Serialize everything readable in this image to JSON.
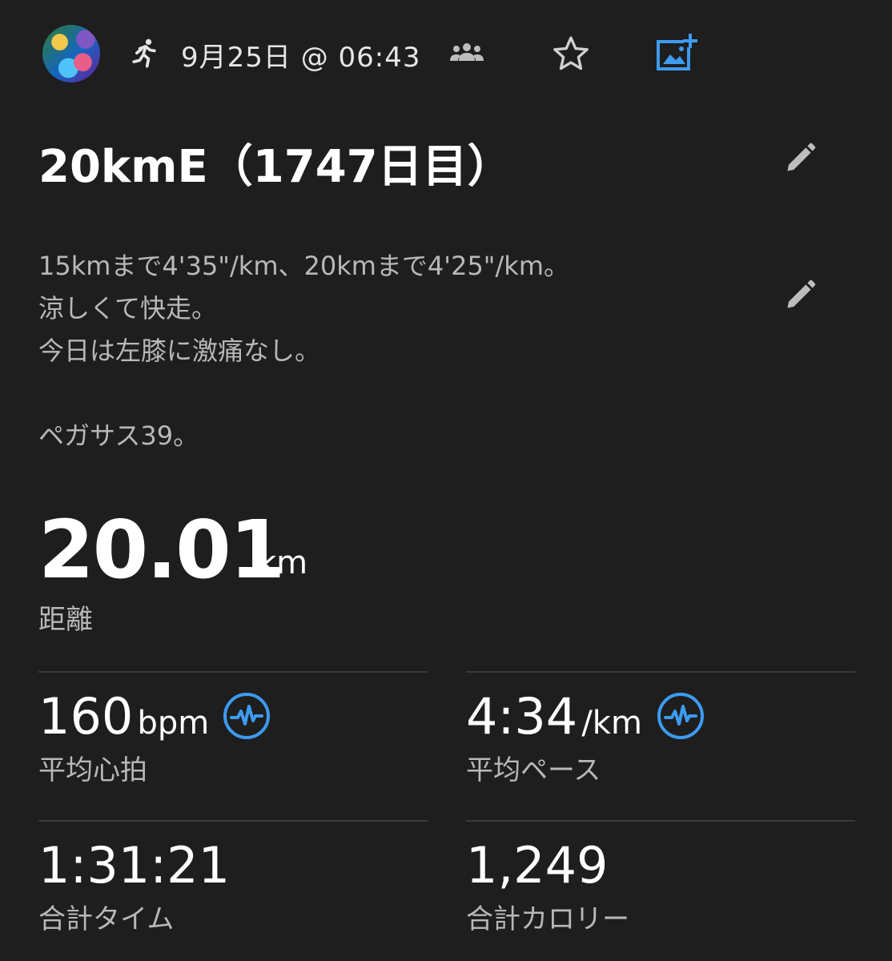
{
  "header": {
    "datetime": "9月25日 @ 06:43",
    "icons": [
      "avatar",
      "running-icon",
      "group-icon",
      "star-icon",
      "add-photo-icon"
    ],
    "accent_color": "#3d9bf0"
  },
  "activity": {
    "title": "20kmE（1747日目）",
    "description_lines": [
      "15kmまで4'35\"/km、20kmまで4'25\"/km。",
      "涼しくて快走。",
      "今日は左膝に激痛なし。",
      "",
      "ペガサス39。"
    ]
  },
  "distance": {
    "value": "20.01",
    "unit": "km",
    "label": "距離"
  },
  "metrics": {
    "heart_rate": {
      "value": "160",
      "unit": "bpm",
      "label": "平均心拍"
    },
    "pace": {
      "value": "4:34",
      "unit": "/km",
      "label": "平均ペース"
    },
    "total_time": {
      "value": "1:31:21",
      "label": "合計タイム"
    },
    "calories": {
      "value": "1,249",
      "label": "合計カロリー"
    }
  }
}
